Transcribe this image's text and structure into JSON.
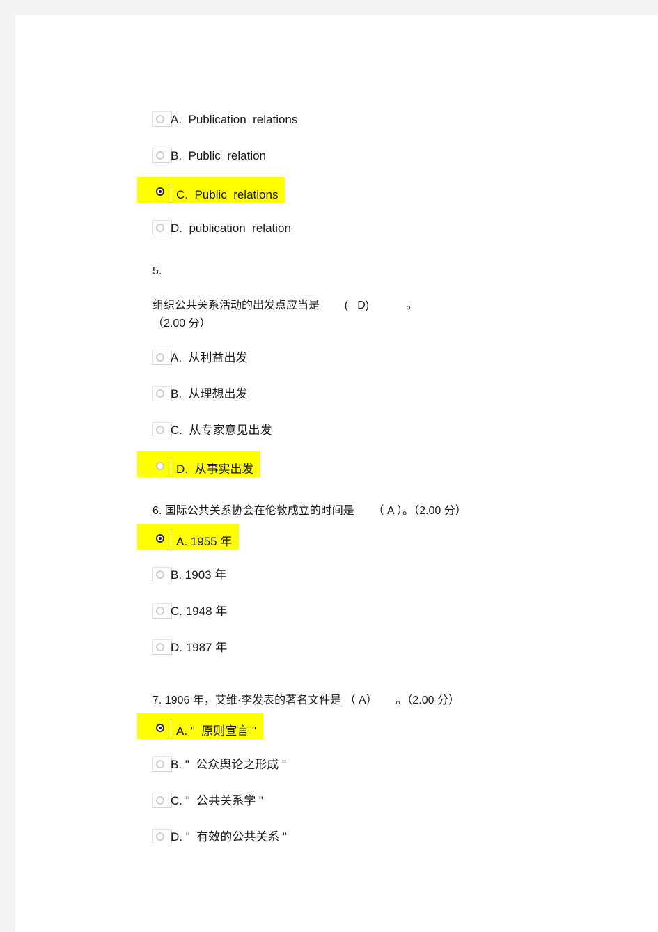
{
  "document": {
    "page_background": "#ffffff",
    "highlight_color": "#ffff00"
  },
  "questions": [
    {
      "id": "q4",
      "number": "",
      "stem": "",
      "options": [
        {
          "key": "A",
          "label": "A.  Publication  relations",
          "selected": false,
          "highlighted": false
        },
        {
          "key": "B",
          "label": "B.  Public  relation",
          "selected": false,
          "highlighted": false
        },
        {
          "key": "C",
          "label": "C.  Public  relations",
          "selected": true,
          "highlighted": true
        },
        {
          "key": "D",
          "label": "D.  publication  relation",
          "selected": false,
          "highlighted": false
        }
      ]
    },
    {
      "id": "q5",
      "number": "5.",
      "stem_line1": "组织公共关系活动的出发点应当是        (   D)            。",
      "stem_line2": "（2.00 分）",
      "answer_letter": "D",
      "points": "（2.00 分）",
      "options": [
        {
          "key": "A",
          "label": "A.  从利益出发",
          "selected": false,
          "highlighted": false
        },
        {
          "key": "B",
          "label": "B.  从理想出发",
          "selected": false,
          "highlighted": false
        },
        {
          "key": "C",
          "label": "C.  从专家意见出发",
          "selected": false,
          "highlighted": false
        },
        {
          "key": "D",
          "label": "D.  从事实出发",
          "selected": false,
          "highlighted": true
        }
      ]
    },
    {
      "id": "q6",
      "number": "6.",
      "stem_inline": "6. 国际公共关系协会在伦敦成立的时间是      （ A ）。（2.00 分）",
      "answer_letter": "A",
      "points": "（2.00 分）",
      "options": [
        {
          "key": "A",
          "label": "A. 1955 年",
          "selected": true,
          "highlighted": true
        },
        {
          "key": "B",
          "label": "B. 1903 年",
          "selected": false,
          "highlighted": false
        },
        {
          "key": "C",
          "label": "C. 1948 年",
          "selected": false,
          "highlighted": false
        },
        {
          "key": "D",
          "label": "D. 1987 年",
          "selected": false,
          "highlighted": false
        }
      ]
    },
    {
      "id": "q7",
      "number": "7.",
      "stem_inline": "7. 1906 年，艾维·李发表的著名文件是 （ A）      。（2.00 分）",
      "answer_letter": "A",
      "points": "（2.00 分）",
      "options": [
        {
          "key": "A",
          "label": "A. \"  原则宣言 \"",
          "selected": true,
          "highlighted": true
        },
        {
          "key": "B",
          "label": "B. \"  公众舆论之形成 \"",
          "selected": false,
          "highlighted": false
        },
        {
          "key": "C",
          "label": "C. \"  公共关系学 \"",
          "selected": false,
          "highlighted": false
        },
        {
          "key": "D",
          "label": "D. \"  有效的公共关系 \"",
          "selected": false,
          "highlighted": false
        }
      ]
    }
  ]
}
